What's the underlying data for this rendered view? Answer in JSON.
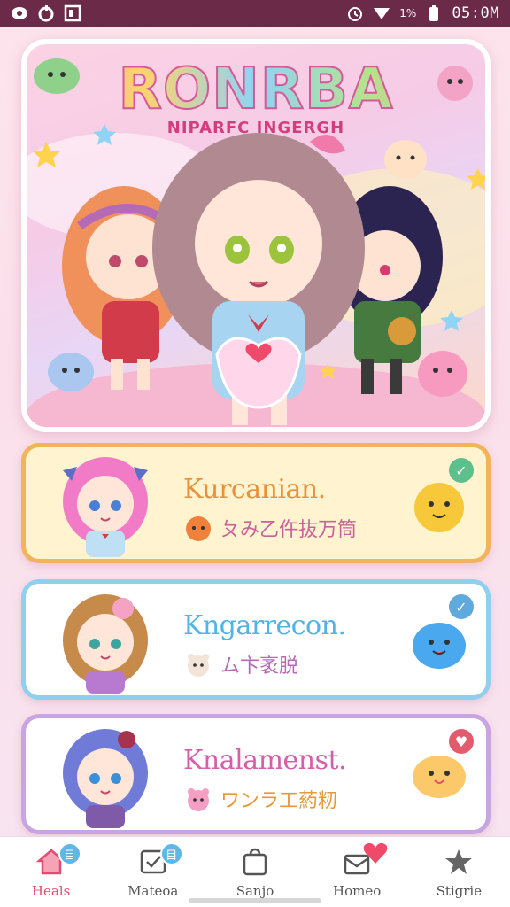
{
  "status_bar": {
    "time": "05:0M",
    "battery": "1%",
    "icons": [
      "messenger-icon",
      "sync-icon",
      "gallery-icon",
      "alarm-icon",
      "wifi-icon",
      "battery-icon"
    ]
  },
  "hero": {
    "title": "RONRBA",
    "subtitle": "NIPARFC INGERGH"
  },
  "cards": [
    {
      "title": "Kurcanian.",
      "subtitle": "ㄆみ乙仵抜万筒",
      "badge": "✓",
      "accent": "#f2b45b"
    },
    {
      "title": "Kngarrecon.",
      "subtitle": "ム卞袤脱",
      "badge": "✓",
      "accent": "#8fd0ef"
    },
    {
      "title": "Knalamenst.",
      "subtitle": "ワンラ工葯籾",
      "badge": "♥",
      "accent": "#c9a4e2"
    }
  ],
  "nav": {
    "items": [
      {
        "label": "Heals",
        "badge": "目"
      },
      {
        "label": "Mateoa",
        "badge": "目"
      },
      {
        "label": "Sanjo",
        "badge": ""
      },
      {
        "label": "Homeo",
        "badge": ""
      },
      {
        "label": "Stigrie",
        "badge": ""
      }
    ]
  },
  "colors": {
    "status_bar": "#6b2a48",
    "active_nav": "#e04c72"
  }
}
